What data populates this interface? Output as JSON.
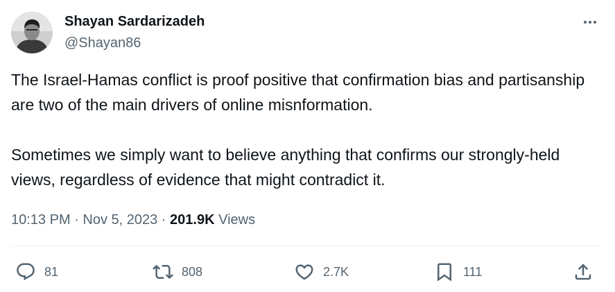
{
  "author": {
    "display_name": "Shayan Sardarizadeh",
    "handle": "@Shayan86",
    "avatar_icon": "avatar-photo"
  },
  "tweet": {
    "paragraphs": [
      "The Israel-Hamas conflict is proof positive that confirmation bias and partisanship are two of the main drivers of online misnformation.",
      "Sometimes we simply want to believe anything that confirms our strongly-held views, regardless of evidence that might contradict it."
    ],
    "time": "10:13 PM",
    "separator": " · ",
    "date": "Nov 5, 2023",
    "views_count": "201.9K",
    "views_label": "Views"
  },
  "actions": {
    "reply_count": "81",
    "retweet_count": "808",
    "like_count": "2.7K",
    "bookmark_count": "111"
  },
  "colors": {
    "text": "#0f1419",
    "secondary": "#536471",
    "divider": "#eff3f4"
  }
}
